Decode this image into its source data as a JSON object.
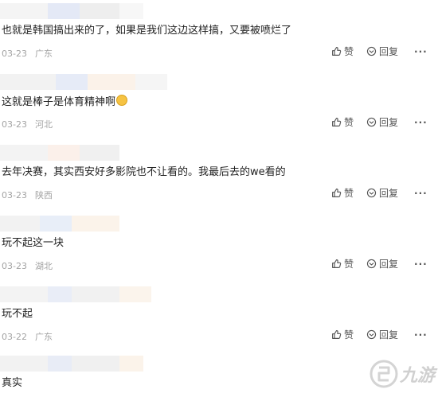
{
  "comments": [
    {
      "text": "也就是韩国搞出来的了，如果是我们这边这样搞，又要被喷烂了",
      "date": "03-23",
      "location": "广东",
      "like_label": "赞",
      "reply_label": "回复",
      "more_label": "···"
    },
    {
      "text": "这就是棒子是体育精神啊",
      "emoji": "astonished-face-emoji",
      "date": "03-23",
      "location": "河北",
      "like_label": "赞",
      "reply_label": "回复",
      "more_label": "···"
    },
    {
      "text": "去年决赛，其实西安好多影院也不让看的。我最后去的we看的",
      "date": "03-23",
      "location": "陕西",
      "like_label": "赞",
      "reply_label": "回复",
      "more_label": "···"
    },
    {
      "text": "玩不起这一块",
      "date": "03-23",
      "location": "湖北",
      "like_label": "赞",
      "reply_label": "回复",
      "more_label": "···"
    },
    {
      "text": "玩不起",
      "date": "03-22",
      "location": "广东",
      "like_label": "赞",
      "reply_label": "回复",
      "more_label": "···"
    },
    {
      "text": "真实"
    }
  ],
  "watermark": {
    "text": "九游",
    "icon": "jiuyou-logo-icon"
  },
  "colors": {
    "text": "#1f1f1f",
    "meta": "#a3a3a3",
    "action": "#555555",
    "watermark": "#d0d0d0"
  }
}
